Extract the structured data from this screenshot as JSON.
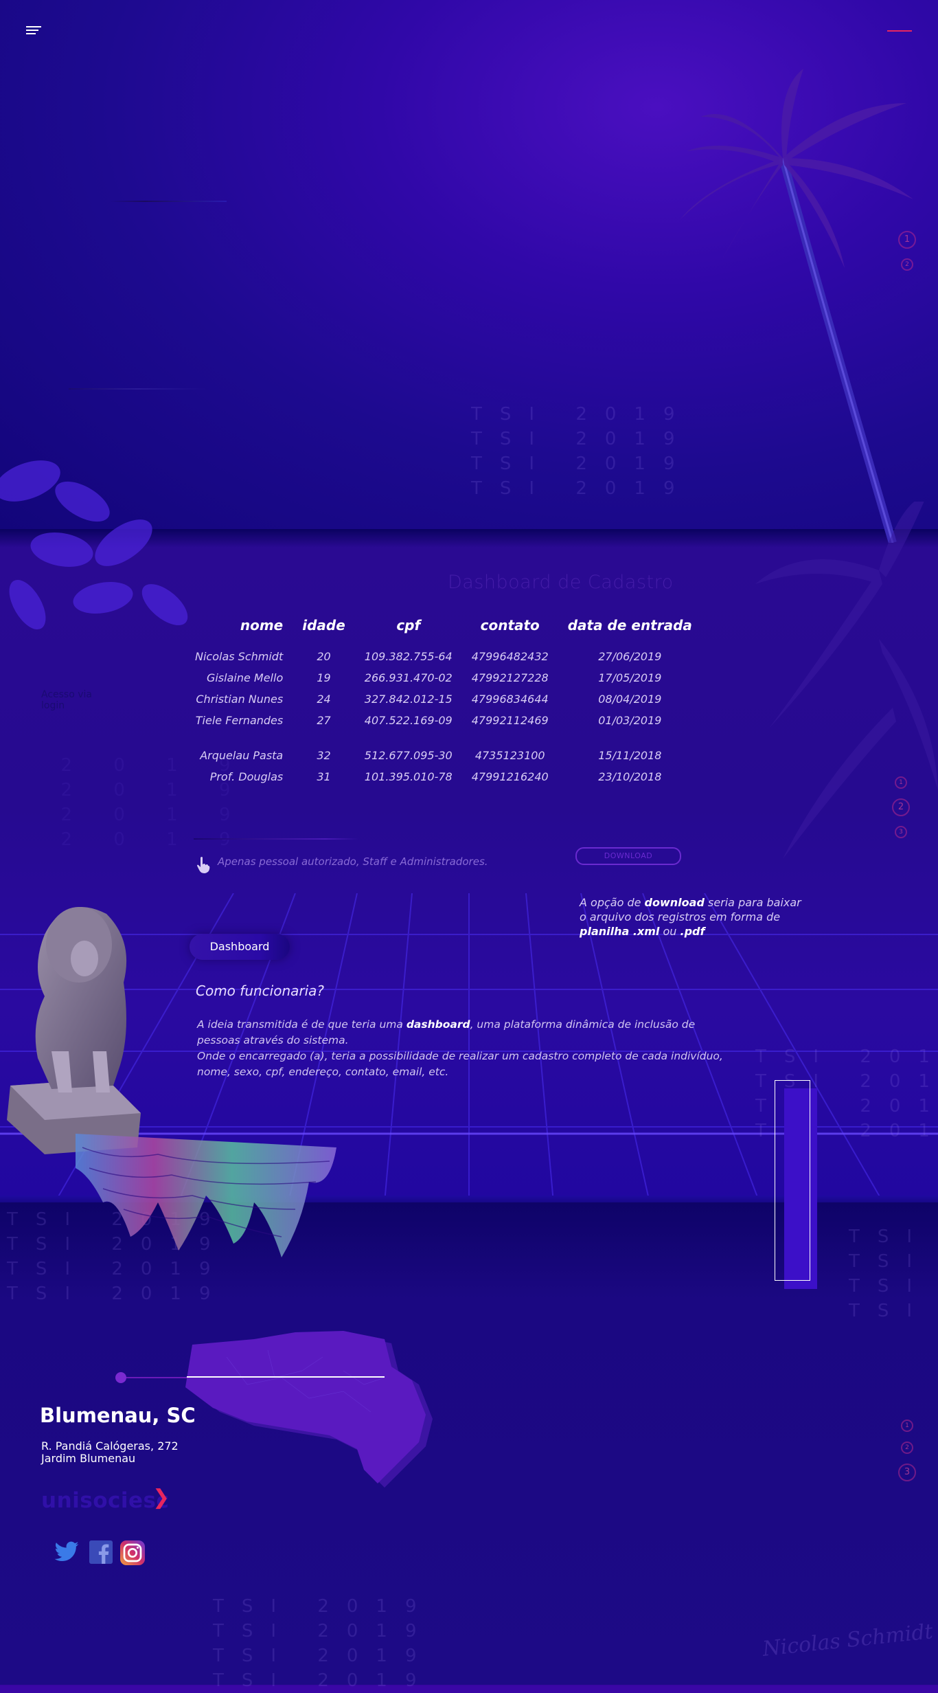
{
  "header": {
    "menu_icon": "hamburger-menu-icon"
  },
  "decor": {
    "tsi_text": "TSI 2019"
  },
  "pagers": {
    "hero": [
      "1",
      "2"
    ],
    "middle": [
      "1",
      "2",
      "3"
    ],
    "footer": [
      "1",
      "2",
      "3"
    ]
  },
  "dashboard": {
    "title": "Dashboard de Cadastro",
    "columns": [
      "nome",
      "idade",
      "cpf",
      "contato",
      "data de entrada"
    ],
    "rows": [
      [
        "Nicolas Schmidt",
        "20",
        "109.382.755-64",
        "47996482432",
        "27/06/2019"
      ],
      [
        "Gislaine Mello",
        "19",
        "266.931.470-02",
        "47992127228",
        "17/05/2019"
      ],
      [
        "Christian Nunes",
        "24",
        "327.842.012-15",
        "47996834644",
        "08/04/2019"
      ],
      [
        "Tiele Fernandes",
        "27",
        "407.522.169-09",
        "47992112469",
        "01/03/2019"
      ],
      [
        "Arquelau Pasta",
        "32",
        "512.677.095-30",
        "4735123100",
        "15/11/2018"
      ],
      [
        "Prof. Douglas",
        "31",
        "101.395.010-78",
        "47991216240",
        "23/10/2018"
      ]
    ],
    "login_link": "Acesso via login",
    "auth_note": "Apenas pessoal autorizado, Staff e Administradores.",
    "download_label": "DOWNLOAD",
    "download_desc_1": "A opção de ",
    "download_desc_b1": "download",
    "download_desc_2": " seria para baixar o arquivo dos registros em forma de ",
    "download_desc_b2": "planilha .xml",
    "download_desc_3": " ou ",
    "download_desc_b3": ".pdf",
    "dashboard_button": "Dashboard",
    "how_title": "Como funcionaria?",
    "how_1": "A ideia transmitida é de que teria uma ",
    "how_b1": "dashboard",
    "how_2": ", uma plataforma dinâmica de inclusão de pessoas através do sistema.",
    "how_3": "Onde o encarregado (a), teria a possibilidade de realizar um cadastro completo de cada indivíduo, nome, sexo, cpf, endereço, contato, email, etc."
  },
  "footer": {
    "city": "Blumenau, SC",
    "street": "R. Pandiá Calógeras, 272",
    "district": "Jardim Blumenau",
    "logo": "unisociesc",
    "logo_arrow": "❯",
    "social": [
      "twitter-icon",
      "facebook-icon",
      "instagram-icon"
    ],
    "signature": "Nicolas Schmidt"
  },
  "colors": {
    "accent": "#e8265e",
    "primary": "#2a0a96",
    "highlight": "#6a2ad0"
  }
}
